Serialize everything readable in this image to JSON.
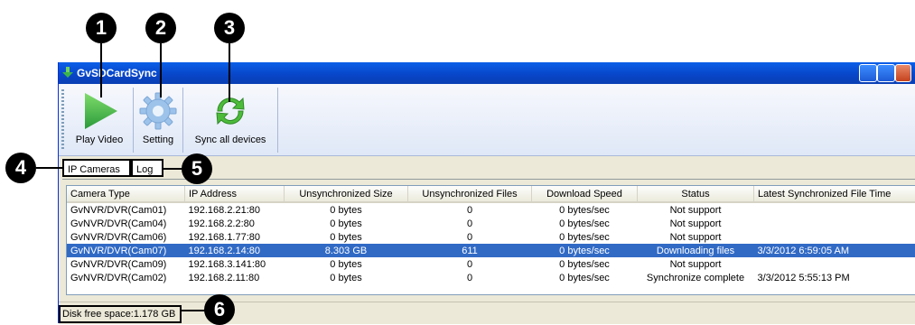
{
  "window": {
    "title": "GvSDCardSync"
  },
  "toolbar": {
    "play_label": "Play Video",
    "setting_label": "Setting",
    "sync_label": "Sync all devices"
  },
  "tabs": [
    {
      "label": "IP Cameras",
      "selected": true
    },
    {
      "label": "Log",
      "selected": false
    }
  ],
  "table": {
    "columns": [
      "Camera Type",
      "IP Address",
      "Unsynchronized Size",
      "Unsynchronized Files",
      "Download Speed",
      "Status",
      "Latest Synchronized File Time"
    ],
    "rows": [
      [
        "GvNVR/DVR(Cam01)",
        "192.168.2.21:80",
        "0 bytes",
        "0",
        "0 bytes/sec",
        "Not support",
        ""
      ],
      [
        "GvNVR/DVR(Cam04)",
        "192.168.2.2:80",
        "0 bytes",
        "0",
        "0 bytes/sec",
        "Not support",
        ""
      ],
      [
        "GvNVR/DVR(Cam06)",
        "192.168.1.77:80",
        "0 bytes",
        "0",
        "0 bytes/sec",
        "Not support",
        ""
      ],
      [
        "GvNVR/DVR(Cam07)",
        "192.168.2.14:80",
        "8.303 GB",
        "611",
        "0 bytes/sec",
        "Downloading files",
        "3/3/2012 6:59:05 AM"
      ],
      [
        "GvNVR/DVR(Cam09)",
        "192.168.3.141:80",
        "0 bytes",
        "0",
        "0 bytes/sec",
        "Not support",
        ""
      ],
      [
        "GvNVR/DVR(Cam02)",
        "192.168.2.11:80",
        "0 bytes",
        "0",
        "0 bytes/sec",
        "Synchronize complete",
        "3/3/2012 5:55:13 PM"
      ]
    ],
    "selected_row": 3
  },
  "status": {
    "disk_free": "Disk free space:1.178 GB"
  },
  "callouts": [
    "1",
    "2",
    "3",
    "4",
    "5",
    "6"
  ],
  "colors": {
    "titlebar": "#0a5fe8",
    "selection": "#316ac5",
    "play_green": "#3cb34a"
  }
}
